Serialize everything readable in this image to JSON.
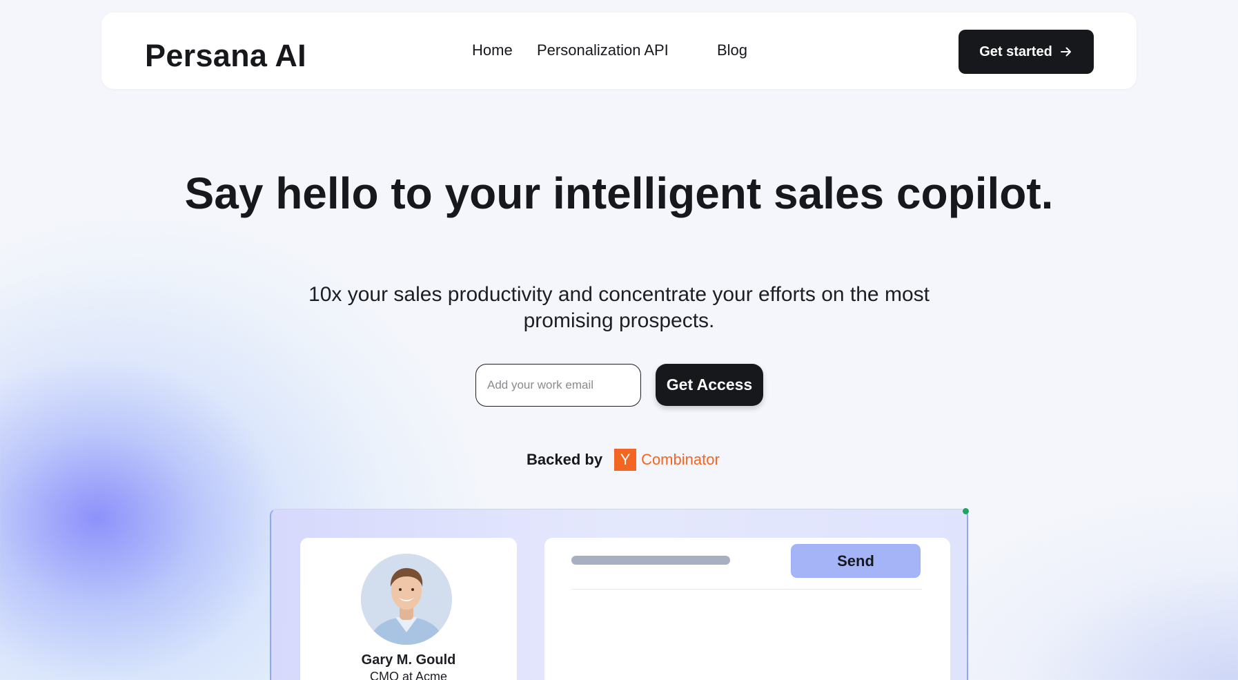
{
  "navbar": {
    "brand": "Persana AI",
    "links": [
      "Home",
      "Personalization API",
      "Blog"
    ],
    "cta_label": "Get started"
  },
  "hero": {
    "title": "Say hello to your intelligent sales copilot.",
    "subtitle": "10x your sales productivity and concentrate your efforts on the most promising prospects."
  },
  "signup": {
    "email_placeholder": "Add your work email",
    "email_value": "",
    "button_label": "Get Access"
  },
  "backed_by": {
    "label": "Backed by",
    "logo_letter": "Y",
    "company": "Combinator",
    "brand_color": "#f26522"
  },
  "preview": {
    "profile": {
      "name": "Gary M. Gould",
      "role": "CMO at Acme"
    },
    "message": {
      "send_label": "Send"
    }
  },
  "icons": {
    "cta_icon": "arrow-right-icon"
  },
  "colors": {
    "primary_dark": "#17181c",
    "send_button": "#a4b4f7",
    "accent_blob": "#8082fa"
  }
}
